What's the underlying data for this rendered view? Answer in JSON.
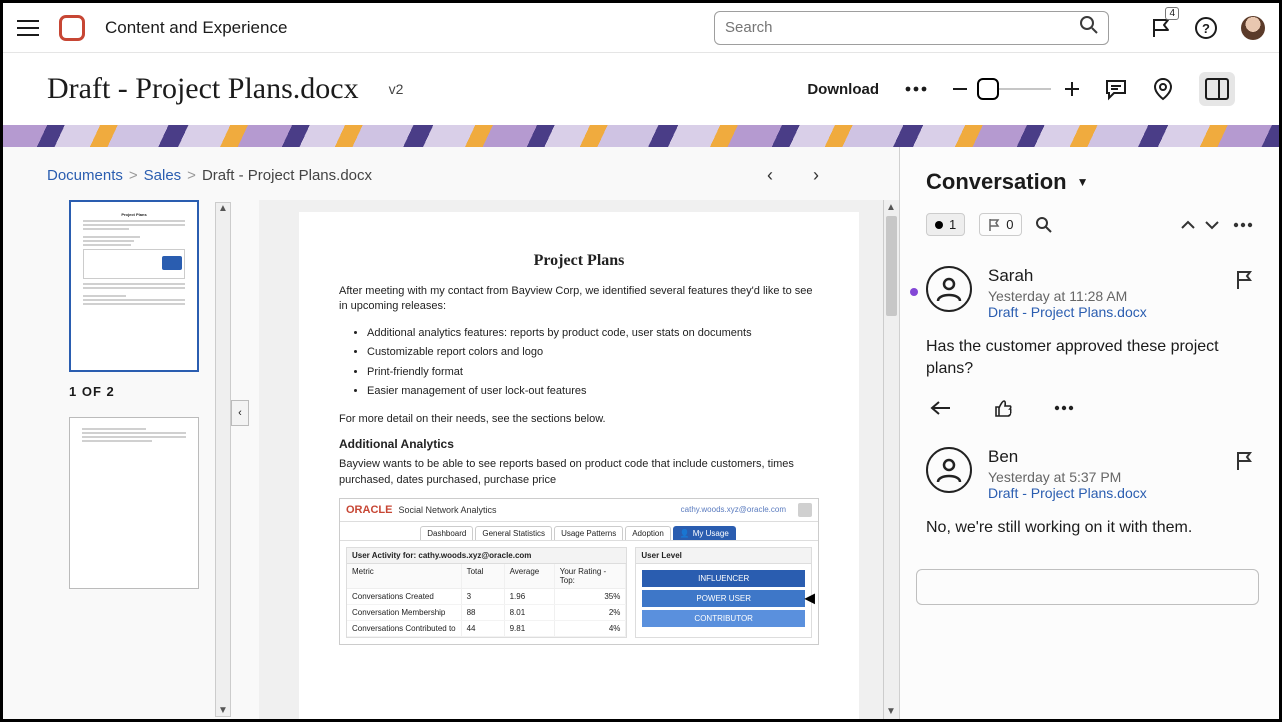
{
  "header": {
    "app_title": "Content and Experience",
    "search_placeholder": "Search",
    "notification_count": "4"
  },
  "doc": {
    "title": "Draft - Project Plans.docx",
    "version": "v2",
    "download_label": "Download"
  },
  "breadcrumb": {
    "root": "Documents",
    "mid": "Sales",
    "current": "Draft - Project Plans.docx"
  },
  "thumbs": {
    "indicator": "1 OF 2"
  },
  "page": {
    "h1": "Project Plans",
    "intro": "After meeting with my contact from Bayview Corp, we identified several features they'd like to see in upcoming releases:",
    "bullets": [
      "Additional analytics features: reports by product code, user stats on documents",
      "Customizable report colors and logo",
      "Print-friendly format",
      "Easier management of user lock-out features"
    ],
    "followup": "For more detail on their needs, see the sections below.",
    "h2": "Additional Analytics",
    "para2": "Bayview wants to be able to see reports based on product code that include customers, times purchased, dates purchased, purchase price",
    "embed": {
      "logo": "ORACLE",
      "title": "Social Network Analytics",
      "user": "cathy.woods.xyz@oracle.com",
      "tabs": [
        "Dashboard",
        "General Statistics",
        "Usage Patterns",
        "Adoption",
        "My Usage"
      ],
      "table_header": "User Activity for: cathy.woods.xyz@oracle.com",
      "columns": [
        "Metric",
        "Total",
        "Average",
        "Your Rating - Top:"
      ],
      "rows": [
        [
          "Conversations Created",
          "3",
          "1.96",
          "35%"
        ],
        [
          "Conversation Membership",
          "88",
          "8.01",
          "2%"
        ],
        [
          "Conversations Contributed to",
          "44",
          "9.81",
          "4%"
        ]
      ],
      "panel_header": "User Level",
      "levels": [
        "INFLUENCER",
        "POWER USER",
        "CONTRIBUTOR"
      ]
    }
  },
  "conversation": {
    "title": "Conversation",
    "unread_count": "1",
    "flag_count": "0",
    "messages": [
      {
        "name": "Sarah",
        "time": "Yesterday at 11:28 AM",
        "link": "Draft - Project Plans.docx",
        "body": "Has the customer approved these project plans?",
        "unread": true
      },
      {
        "name": "Ben",
        "time": "Yesterday at 5:37 PM",
        "link": "Draft - Project Plans.docx",
        "body": "No, we're still working on it with them.",
        "unread": false
      }
    ]
  }
}
